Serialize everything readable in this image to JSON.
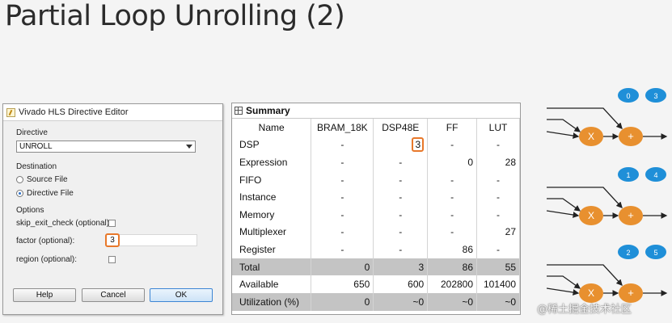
{
  "slide": {
    "title": "Partial Loop Unrolling (2)"
  },
  "dialog": {
    "title": "Vivado HLS Directive Editor",
    "directive_label": "Directive",
    "directive_value": "UNROLL",
    "destination_label": "Destination",
    "source_file_label": "Source File",
    "directive_file_label": "Directive File",
    "options_label": "Options",
    "skip_exit_label": "skip_exit_check (optional):",
    "factor_label": "factor (optional):",
    "factor_value": "3",
    "region_label": "region (optional):",
    "help_label": "Help",
    "cancel_label": "Cancel",
    "ok_label": "OK"
  },
  "summary": {
    "title": "Summary",
    "columns": [
      "Name",
      "BRAM_18K",
      "DSP48E",
      "FF",
      "LUT"
    ],
    "rows": [
      [
        "DSP",
        "-",
        "3",
        "-",
        "-"
      ],
      [
        "Expression",
        "-",
        "-",
        "0",
        "28"
      ],
      [
        "FIFO",
        "-",
        "-",
        "-",
        "-"
      ],
      [
        "Instance",
        "-",
        "-",
        "-",
        "-"
      ],
      [
        "Memory",
        "-",
        "-",
        "-",
        "-"
      ],
      [
        "Multiplexer",
        "-",
        "-",
        "-",
        "27"
      ],
      [
        "Register",
        "-",
        "-",
        "86",
        "-"
      ],
      [
        "Total",
        "0",
        "3",
        "86",
        "55"
      ],
      [
        "Available",
        "650",
        "600",
        "202800",
        "101400"
      ],
      [
        "Utilization (%)",
        "0",
        "~0",
        "~0",
        "~0"
      ]
    ]
  },
  "diagram": {
    "badges": [
      "0",
      "3",
      "1",
      "4",
      "2",
      "5"
    ],
    "mult_symbol": "X",
    "add_symbol": "+",
    "colors": {
      "operator": "#e8902f",
      "badge": "#1f8fd8"
    }
  },
  "watermark": "@稀土掘金技术社区"
}
